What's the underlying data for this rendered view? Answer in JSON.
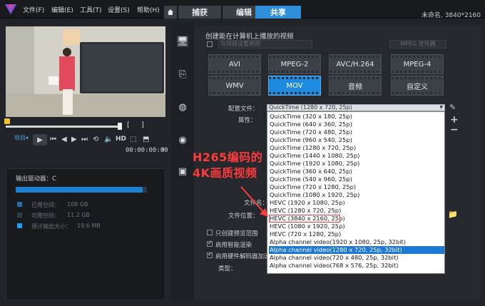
{
  "menu": {
    "file": "文件(F)",
    "edit": "编辑(E)",
    "tools": "工具(T)",
    "settings": "设置(S)",
    "help": "帮助(H)"
  },
  "tabs": {
    "capture": "捕获",
    "edit": "编辑",
    "share": "共享"
  },
  "project": {
    "name": "未命名, 3840*2160"
  },
  "player": {
    "project_label": "项目▾",
    "hd": "HD",
    "timecode": "00:00:00:00"
  },
  "disk": {
    "drive_label": "输出驱动器：C",
    "used_fraction": 0.97,
    "used_label": "已用空间：",
    "used_value": "108 GB",
    "free_label": "可用空间：",
    "free_value": "11.2 GB",
    "est_label": "预计输出大小：",
    "est_value": "19.6 MB",
    "colors": {
      "used": "#1e6fb0",
      "free": "#2e3c4a",
      "est": "#1ea0f0"
    }
  },
  "share": {
    "title": "创建能在计算机上播放的视频",
    "profile_placeholder": "与项目设置相同",
    "mpeg_opt": "MPEG 优化器",
    "formats": [
      "AVI",
      "MPEG-2",
      "AVC/H.264",
      "MPEG-4",
      "WMV",
      "MOV",
      "音频",
      "自定义"
    ],
    "active_format": "MOV",
    "config_label": "配置文件：",
    "props_label": "属性：",
    "filename_label": "文件名：",
    "location_label": "文件位置：",
    "config_value": "QuickTime (1280 x 720, 25p)",
    "options": [
      "QuickTime (320 x 180, 25p)",
      "QuickTime (640 x 360, 25p)",
      "QuickTime (720 x 480, 25p)",
      "QuickTime (960 x 540, 25p)",
      "QuickTime (1280 x 720, 25p)",
      "QuickTime (1440 x 1080, 25p)",
      "QuickTime (1920 x 1080, 25p)",
      "QuickTime (360 x 640, 25p)",
      "QuickTime (540 x 960, 25p)",
      "QuickTime (720 x 1280, 25p)",
      "QuickTime (1080 x 1920, 25p)",
      "HEVC (1920 x 1080, 25p)",
      "HEVC (1280 x 720, 25p)",
      "HEVC (3840 x 2160, 25p)",
      "HEVC (1080 x 1920, 25p)",
      "HEVC (720 x 1280, 25p)",
      "Alpha channel video(1920 x 1080, 25p, 32bit)",
      "Alpha channel video(1280 x 720, 25p, 32bit)",
      "Alpha channel video(720 x 480, 25p, 32bit)",
      "Alpha channel video(768 x 576, 25p, 32bit)"
    ],
    "highlighted_index": 13,
    "selected_index": 17,
    "chk_preview": "只创建预览范围",
    "chk_smart": "启用智能渲染",
    "chk_hw": "启用硬件解码器加速",
    "type_label": "类型："
  },
  "annotation": {
    "line1": "H265编码的",
    "line2": "4K画质视频"
  }
}
